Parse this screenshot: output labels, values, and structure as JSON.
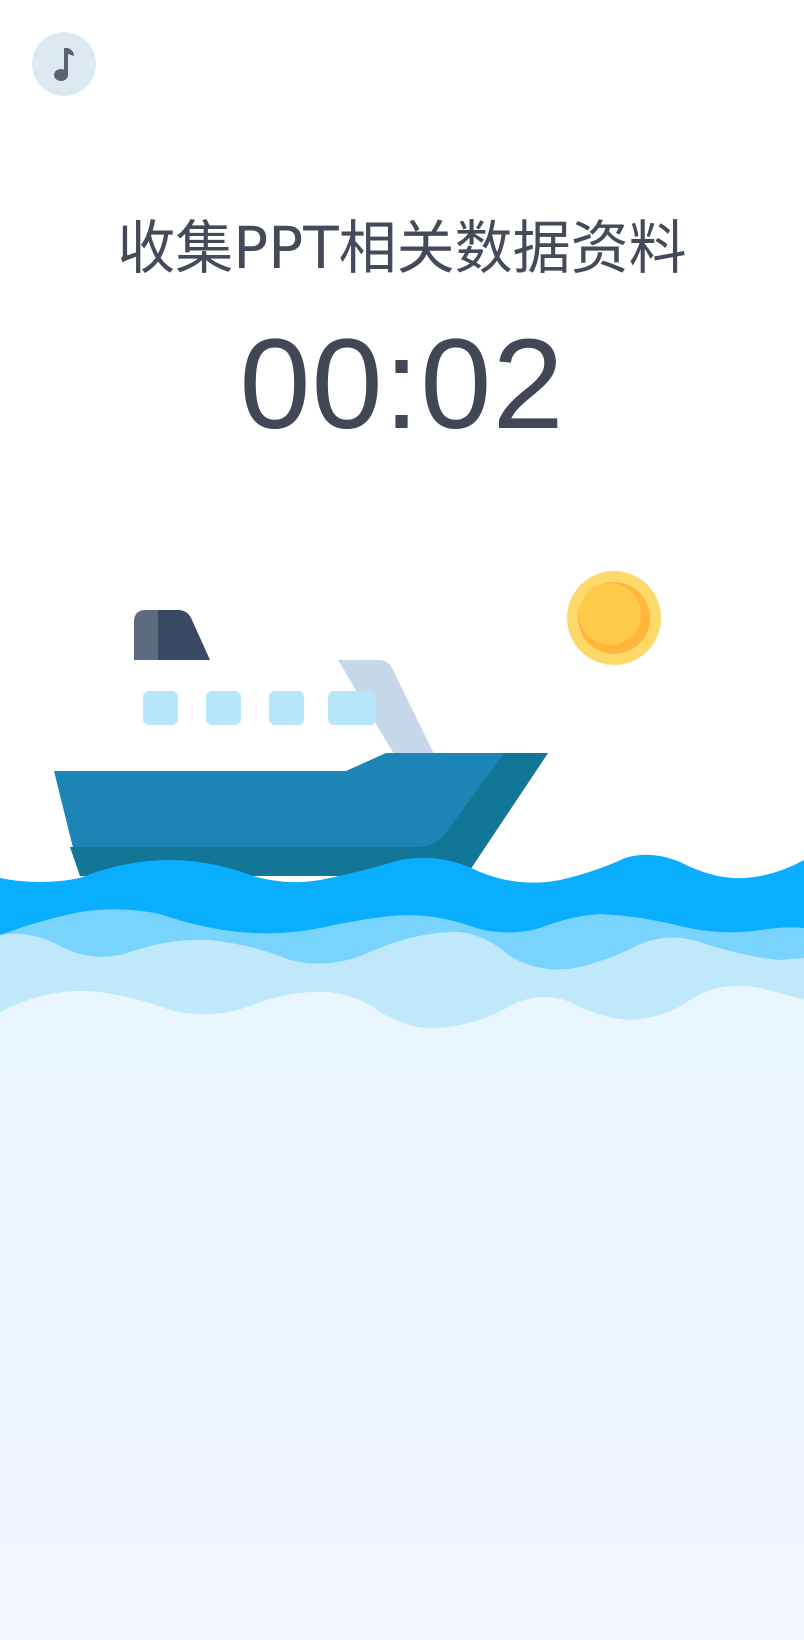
{
  "music_button": {
    "icon": "music-note-icon"
  },
  "task": {
    "title": "收集PPT相关数据资料"
  },
  "timer": {
    "value": "00:02"
  },
  "illustration": {
    "boat_icon": "ship-icon",
    "sun_icon": "sun-icon",
    "waves_icon": "waves-icon"
  },
  "colors": {
    "text": "#454a5a",
    "hull": "#1c85b6",
    "hull_dark": "#127696",
    "wave_front": "#0aaefe",
    "wave_mid": "#78d3fd",
    "wave_back": "#bfe8fb",
    "sun": "#ffc94a",
    "background_bottom": "#f2f6fd"
  }
}
